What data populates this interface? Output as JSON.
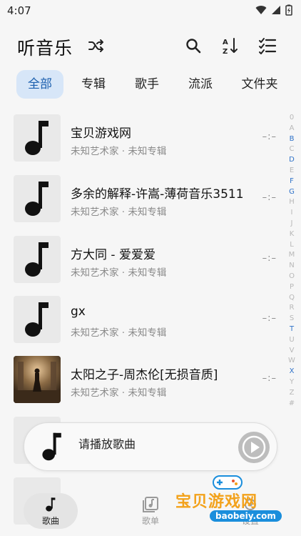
{
  "status": {
    "time": "4:07"
  },
  "app": {
    "title": "听音乐"
  },
  "tabs": [
    {
      "label": "全部",
      "active": true
    },
    {
      "label": "专辑",
      "active": false
    },
    {
      "label": "歌手",
      "active": false
    },
    {
      "label": "流派",
      "active": false
    },
    {
      "label": "文件夹",
      "active": false
    }
  ],
  "songs": [
    {
      "title": "宝贝游戏网",
      "artist": "未知艺术家",
      "sep": "·",
      "album": "未知专辑",
      "duration": "–:–"
    },
    {
      "title": "多余的解释-许嵩-薄荷音乐3511",
      "artist": "未知艺术家",
      "sep": "·",
      "album": "未知专辑",
      "duration": "–:–"
    },
    {
      "title": "方大同 - 爱爱爱",
      "artist": "未知艺术家",
      "sep": "·",
      "album": "未知专辑",
      "duration": "–:–"
    },
    {
      "title": "gx",
      "artist": "未知艺术家",
      "sep": "·",
      "album": "未知专辑",
      "duration": "–:–"
    },
    {
      "title": "太阳之子-周杰伦[无损音质]",
      "artist": "未知艺术家",
      "sep": "·",
      "album": "未知专辑",
      "duration": "–:–"
    }
  ],
  "alphabet": [
    "0",
    "A",
    "B",
    "C",
    "D",
    "E",
    "F",
    "G",
    "H",
    "I",
    "J",
    "K",
    "L",
    "M",
    "N",
    "O",
    "P",
    "Q",
    "R",
    "S",
    "T",
    "U",
    "V",
    "W",
    "X",
    "Y",
    "Z",
    "#"
  ],
  "alphabet_active": [
    "B",
    "D",
    "F",
    "G",
    "T",
    "X"
  ],
  "player": {
    "text": "请播放歌曲"
  },
  "nav": [
    {
      "label": "歌曲",
      "icon": "music-note-icon",
      "active": true
    },
    {
      "label": "歌单",
      "icon": "playlist-icon",
      "active": false
    },
    {
      "label": "设置",
      "icon": "settings-icon",
      "active": false
    }
  ],
  "watermark": {
    "text": "宝贝游戏网",
    "sub": "baobeiy.com"
  },
  "colors": {
    "accent": "#1b5fae",
    "tab_active_bg": "#d7e6f8",
    "index_active": "#2f72c8"
  }
}
